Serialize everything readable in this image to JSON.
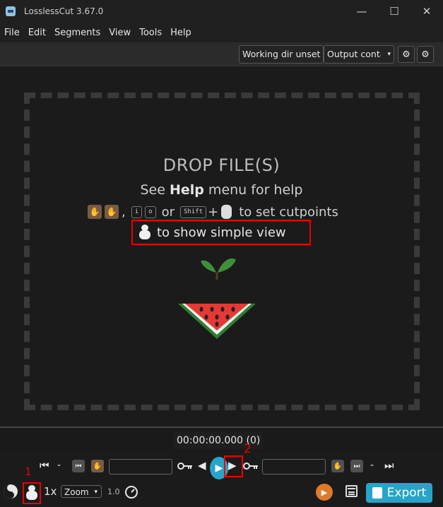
{
  "window": {
    "title": "LosslessCut 3.67.0",
    "minimize": "—",
    "maximize": "☐",
    "close": "✕"
  },
  "menu": [
    "File",
    "Edit",
    "Segments",
    "View",
    "Tools",
    "Help"
  ],
  "toolbar": {
    "working_dir": "Working dir unset",
    "output_container": "Output conta",
    "dropdown_caret": "▾",
    "settings1": "⚙",
    "settings2": "⚙"
  },
  "drop": {
    "title": "DROP FILE(S)",
    "help_prefix": "See ",
    "help_bold": "Help",
    "help_suffix": " menu for help",
    "comma": ",",
    "key_i": "i",
    "key_o": "o",
    "or": "or",
    "key_shift": "Shift",
    "plus": "+",
    "cutpoints": "to set cutpoints",
    "simple_view": "to show simple view"
  },
  "timeline": {
    "time": "00:00:00.000 (0)"
  },
  "controls": {
    "dash": "-",
    "speed": "1x",
    "zoom": "Zoom",
    "zoom_caret": "▾",
    "zoom_value": "1.0",
    "export": "Export"
  },
  "annotations": {
    "one": "1",
    "two": "2"
  },
  "colors": {
    "accent": "#28a4c8",
    "highlight": "#e00000",
    "hand": "#7a5a45",
    "play_orange": "#e07a2b"
  }
}
